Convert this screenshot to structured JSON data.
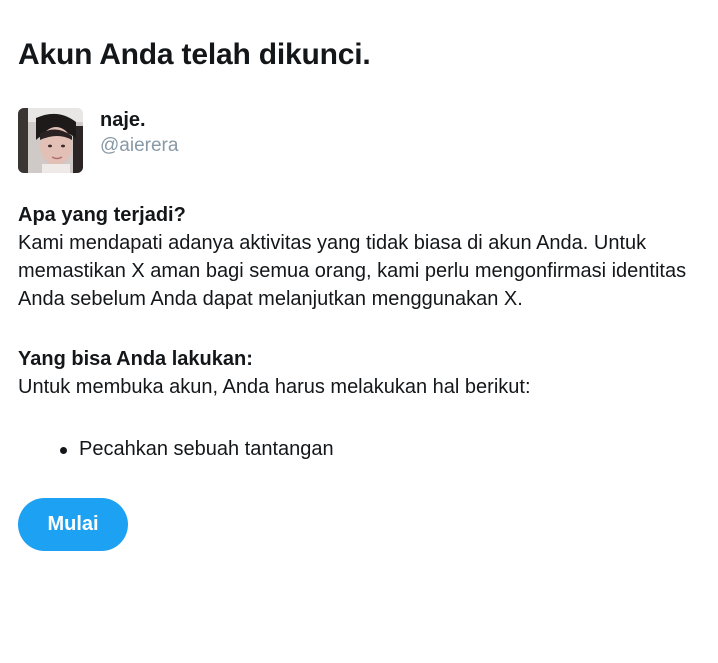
{
  "page": {
    "title": "Akun Anda telah dikunci."
  },
  "user": {
    "display_name": "naje.",
    "handle": "@aierera",
    "avatar_icon": "profile-photo"
  },
  "what_happened": {
    "heading": "Apa yang terjadi?",
    "body": "Kami mendapati adanya aktivitas yang tidak biasa di akun Anda. Untuk memastikan X aman bagi semua orang, kami perlu mengonfirmasi identitas Anda sebelum Anda dapat melanjutkan menggunakan X."
  },
  "what_you_can_do": {
    "heading": "Yang bisa Anda lakukan:",
    "body": "Untuk membuka akun, Anda harus melakukan hal berikut:",
    "steps": [
      "Pecahkan sebuah tantangan"
    ]
  },
  "actions": {
    "start_label": "Mulai"
  },
  "colors": {
    "accent": "#1da1f2",
    "text": "#14171a",
    "muted": "#8899a6"
  }
}
